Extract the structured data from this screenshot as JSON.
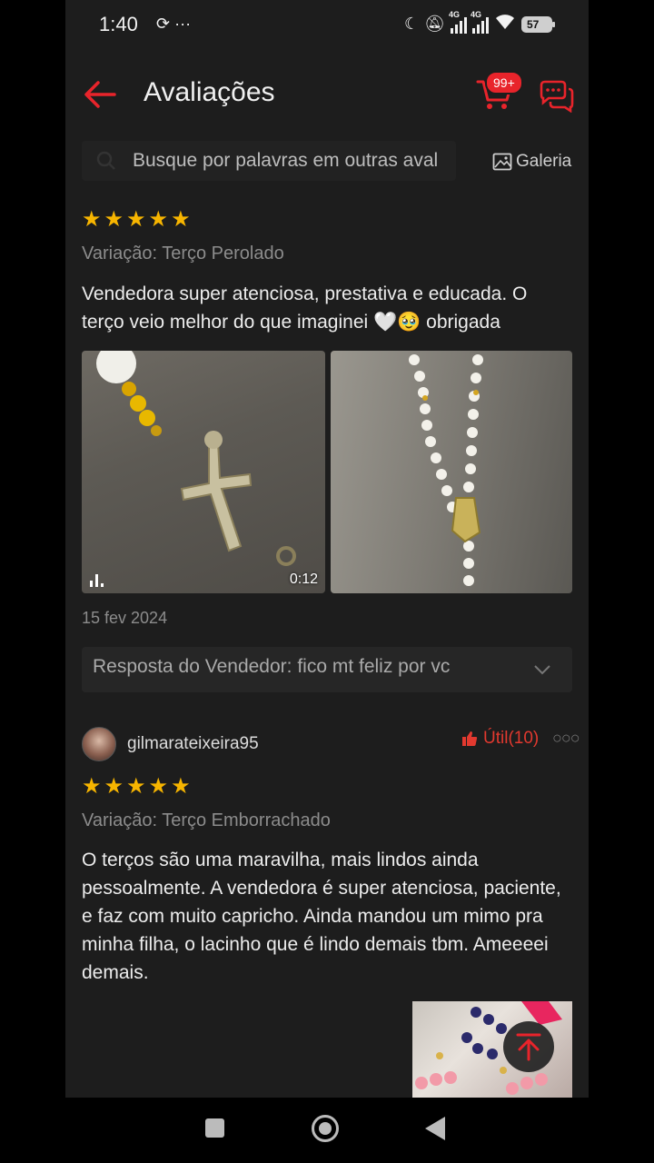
{
  "status_bar": {
    "time": "1:40",
    "left_icons": "⟳ ···",
    "net1": "4G",
    "net2": "4G",
    "battery": "57"
  },
  "header": {
    "title": "Avaliações",
    "cart_badge": "99+"
  },
  "search": {
    "placeholder": "Busque por palavras em outras aval",
    "gallery_label": "Galeria"
  },
  "reviews": [
    {
      "stars": 5,
      "variation": "Variação: Terço Perolado",
      "text": "Vendedora super atenciosa, prestativa e educada. O terço veio melhor do que imaginei 🤍🥹 obrigada",
      "video_duration": "0:12",
      "date": "15 fev 2024",
      "seller_reply": "Resposta do Vendedor: fico mt feliz por vc"
    },
    {
      "stars": 5,
      "username": "gilmarateixeira95",
      "helpful_label": "Útil(10)",
      "variation": "Variação: Terço Emborrachado",
      "text": "O terços são uma maravilha, mais lindos ainda pessoalmente. A vendedora é super atenciosa, paciente, e faz com muito capricho. Ainda mandou um mimo pra minha filha, o lacinho que é lindo demais tbm. Ameeeei demais."
    }
  ],
  "colors": {
    "accent": "#e8242b",
    "star": "#f7b500",
    "background": "#1d1d1d"
  }
}
